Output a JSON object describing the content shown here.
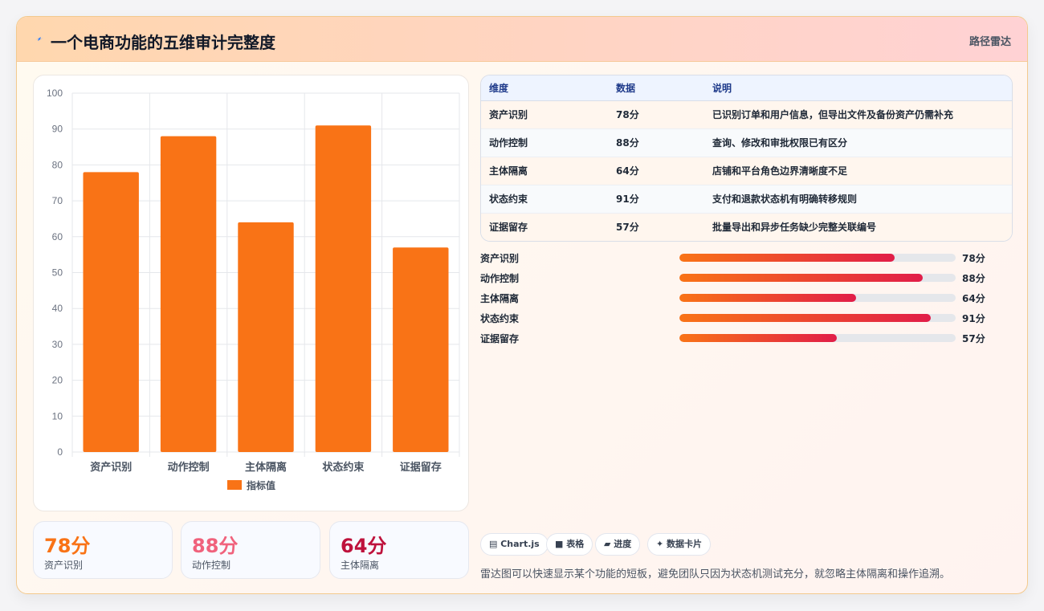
{
  "header": {
    "title": "一个电商功能的五维审计完整度",
    "tag": "路径雷达",
    "icon": "lightning-icon"
  },
  "colors": {
    "bar": "#f97316",
    "accent_orange": "#f97316",
    "accent_pink": "#f0627c",
    "accent_crimson": "#be123c",
    "gradient_end": "#e11d48"
  },
  "chart_data": {
    "type": "bar",
    "categories": [
      "资产识别",
      "动作控制",
      "主体隔离",
      "状态约束",
      "证据留存"
    ],
    "series": [
      {
        "name": "指标值",
        "values": [
          78,
          88,
          64,
          91,
          57
        ]
      }
    ],
    "ylim": [
      0,
      100
    ],
    "yticks": [
      0,
      10,
      20,
      30,
      40,
      50,
      60,
      70,
      80,
      90,
      100
    ],
    "grid": true,
    "legend": "bottom"
  },
  "stats": [
    {
      "value": "78分",
      "label": "资产识别"
    },
    {
      "value": "88分",
      "label": "动作控制"
    },
    {
      "value": "64分",
      "label": "主体隔离"
    }
  ],
  "table": {
    "headers": [
      "维度",
      "数据",
      "说明"
    ],
    "rows": [
      [
        "资产识别",
        "78分",
        "已识别订单和用户信息，但导出文件及备份资产仍需补充"
      ],
      [
        "动作控制",
        "88分",
        "查询、修改和审批权限已有区分"
      ],
      [
        "主体隔离",
        "64分",
        "店铺和平台角色边界清晰度不足"
      ],
      [
        "状态约束",
        "91分",
        "支付和退款状态机有明确转移规则"
      ],
      [
        "证据留存",
        "57分",
        "批量导出和异步任务缺少完整关联编号"
      ]
    ]
  },
  "progress": [
    {
      "label": "资产识别",
      "value": 78,
      "text": "78分"
    },
    {
      "label": "动作控制",
      "value": 88,
      "text": "88分"
    },
    {
      "label": "主体隔离",
      "value": 64,
      "text": "64分"
    },
    {
      "label": "状态约束",
      "value": 91,
      "text": "91分"
    },
    {
      "label": "证据留存",
      "value": 57,
      "text": "57分"
    }
  ],
  "chips": [
    {
      "label": "▤ Chart.js",
      "icon": "chart-icon"
    },
    {
      "label": "■ 表格",
      "icon": "table-icon"
    },
    {
      "label": "▰ 进度",
      "icon": "progress-icon"
    },
    {
      "label": "✦ 数据卡片",
      "icon": "card-icon"
    }
  ],
  "note": "雷达图可以快速显示某个功能的短板，避免团队只因为状态机测试充分，就忽略主体隔离和操作追溯。"
}
